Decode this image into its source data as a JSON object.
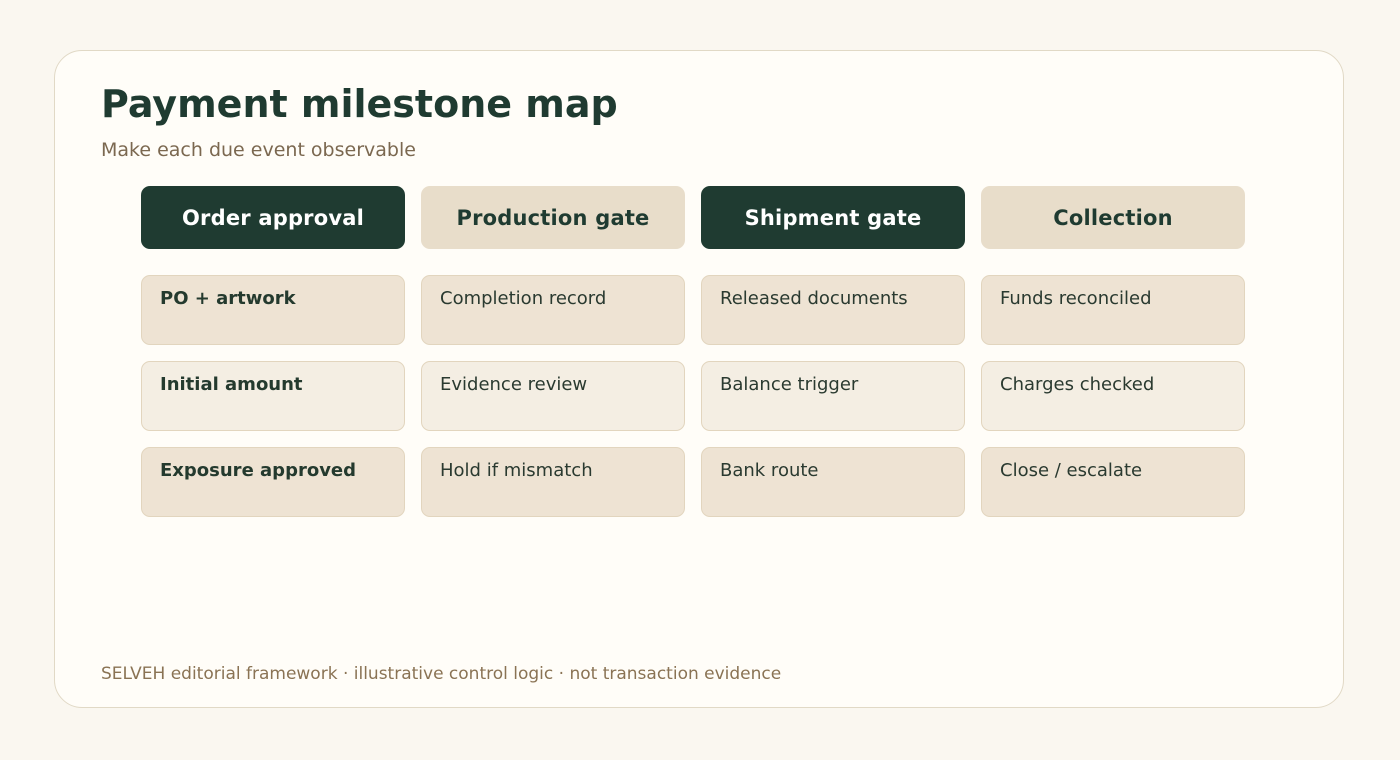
{
  "title": "Payment milestone map",
  "subtitle": "Make each due event observable",
  "columns": [
    {
      "header": "Order approval",
      "style": "dark",
      "cells": [
        "PO + artwork",
        "Initial amount",
        "Exposure approved"
      ]
    },
    {
      "header": "Production gate",
      "style": "light",
      "cells": [
        "Completion record",
        "Evidence review",
        "Hold if mismatch"
      ]
    },
    {
      "header": "Shipment gate",
      "style": "dark",
      "cells": [
        "Released documents",
        "Balance trigger",
        "Bank route"
      ]
    },
    {
      "header": "Collection",
      "style": "light",
      "cells": [
        "Funds reconciled",
        "Charges checked",
        "Close / escalate"
      ]
    }
  ],
  "footer": "SELVEH editorial framework · illustrative control logic · not transaction evidence",
  "colors": {
    "dark_header": "#1f3b31",
    "light_header": "#e8ddca",
    "cell_tone_a": "#eee3d3",
    "cell_tone_b": "#f4eee3",
    "accent_text": "#7b6850"
  }
}
